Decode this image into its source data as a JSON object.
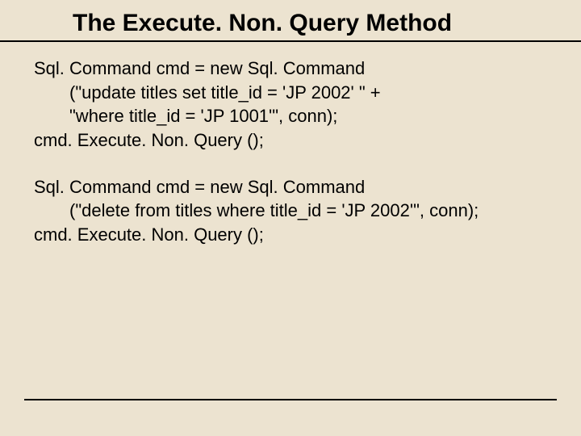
{
  "title": "The Execute. Non. Query Method",
  "block1": {
    "l1": "Sql. Command cmd = new Sql. Command",
    "l2": "(\"update titles set title_id = 'JP 2002' \" +",
    "l3": "\"where title_id = 'JP 1001'\", conn);",
    "l4": "cmd. Execute. Non. Query ();"
  },
  "block2": {
    "l1": "Sql. Command cmd = new Sql. Command",
    "l2": "(\"delete from titles where title_id = 'JP 2002'\", conn);",
    "l3": "cmd. Execute. Non. Query ();"
  }
}
